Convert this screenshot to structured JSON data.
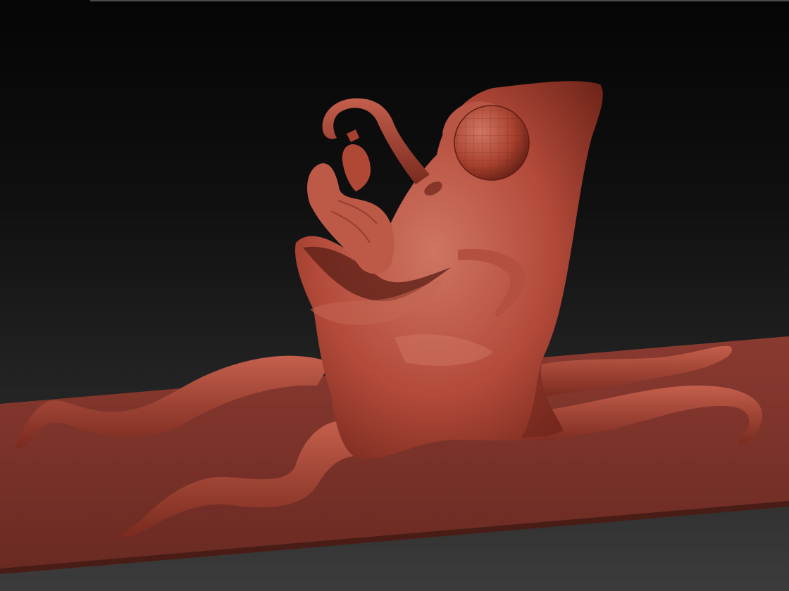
{
  "viewport": {
    "background_top": "#050505",
    "background_bottom": "#3c3c3c"
  },
  "sculpt": {
    "material_color": "#b34a3a",
    "highlight_color": "#d9836f",
    "shadow_color": "#5a1d14"
  },
  "floor": {
    "color": "#7a3128"
  }
}
